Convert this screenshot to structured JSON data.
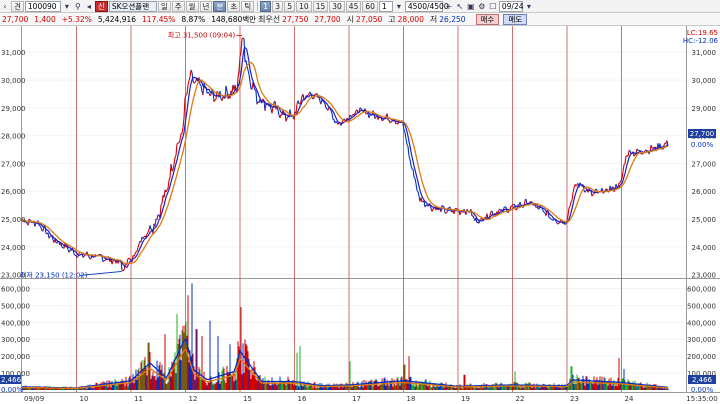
{
  "toolbar": {
    "period_first": "견",
    "code": "100090",
    "chart_badge": "신",
    "stock_name": "SK오션플랜",
    "periods": [
      "일",
      "주",
      "월",
      "년",
      "분",
      "초",
      "틱"
    ],
    "intervals": [
      "1",
      "3",
      "5",
      "10",
      "15",
      "30",
      "45",
      "60"
    ],
    "interval_value": "1",
    "count": "4500/4500",
    "date": "09/24"
  },
  "quote": {
    "price": "27,700",
    "change": "1,400",
    "change_pct": "+5.32%",
    "volume": "5,424,916",
    "volume_ratio": "117.45%",
    "turnover": "8.87%",
    "amount": "148,680백만",
    "hoga_label": "최우선",
    "hoga_value": "27,750",
    "close_value": "27,700",
    "open_label": "시",
    "open": "27,050",
    "high_label": "고",
    "high": "28,000",
    "low_label": "저",
    "low": "26,250",
    "buy": "매수",
    "sell": "매도"
  },
  "legend": {
    "lc": "LC:19.65",
    "hc": "HC:-12.06"
  },
  "annotations": {
    "high": "최고 31,500 (09:04)",
    "low": "최저 23,150 (12:02)"
  },
  "price_axis": {
    "ticks": [
      "31,000",
      "30,000",
      "29,000",
      "28,000",
      "27,000",
      "26,000",
      "25,000",
      "24,000",
      "23,000"
    ],
    "current": "27,700",
    "current_pct": "0.00%"
  },
  "volume_axis": {
    "ticks": [
      "600,000",
      "500,000",
      "400,000",
      "300,000",
      "200,000",
      "100,000"
    ],
    "current": "2,466",
    "current_pct": "0.00%",
    "left_ticks": [
      "600,000",
      "500,000",
      "400,000",
      "300,000",
      "200,000",
      "100,000"
    ],
    "left_current": "2,466",
    "left_current_pct": "0.00%"
  },
  "date_axis": {
    "labels": [
      "09/09",
      "10",
      "11",
      "12",
      "15",
      "16",
      "17",
      "18",
      "19",
      "22",
      "23",
      "24"
    ],
    "time": "15:35:00"
  },
  "colors": {
    "up": "#d40000",
    "down": "#0030c0",
    "ma_short": "#2020c0",
    "ma_long": "#e07a10",
    "vol_green": "#22b022",
    "day_sep": "#c0504d"
  },
  "chart_data": {
    "type": "line",
    "price_ylim": [
      22950,
      31800
    ],
    "volume_ylim": [
      0,
      650000
    ],
    "days": [
      "09/09",
      "10",
      "11",
      "12",
      "15",
      "16",
      "17",
      "18",
      "19",
      "22",
      "23",
      "24"
    ],
    "price_profile": [
      [
        0,
        24950
      ],
      [
        0.3,
        24850
      ],
      [
        0.55,
        24300
      ],
      [
        1.0,
        23750
      ],
      [
        1.5,
        23600
      ],
      [
        1.8,
        23450
      ],
      [
        2.0,
        23500
      ],
      [
        2.2,
        24300
      ],
      [
        2.45,
        24900
      ],
      [
        2.65,
        26000
      ],
      [
        2.8,
        27300
      ],
      [
        2.95,
        28200
      ],
      [
        3.0,
        29300
      ],
      [
        3.08,
        30100
      ],
      [
        3.25,
        29800
      ],
      [
        3.5,
        29400
      ],
      [
        3.75,
        29500
      ],
      [
        3.95,
        29700
      ],
      [
        4.0,
        30800
      ],
      [
        4.05,
        31200
      ],
      [
        4.15,
        30300
      ],
      [
        4.3,
        29400
      ],
      [
        4.6,
        29000
      ],
      [
        4.85,
        28700
      ],
      [
        5.0,
        28700
      ],
      [
        5.1,
        29300
      ],
      [
        5.3,
        29500
      ],
      [
        5.55,
        29200
      ],
      [
        5.8,
        28400
      ],
      [
        6.0,
        28700
      ],
      [
        6.2,
        28900
      ],
      [
        6.5,
        28700
      ],
      [
        6.8,
        28600
      ],
      [
        7.0,
        28400
      ],
      [
        7.1,
        27300
      ],
      [
        7.3,
        25700
      ],
      [
        7.55,
        25400
      ],
      [
        7.8,
        25300
      ],
      [
        8.0,
        25300
      ],
      [
        8.2,
        25300
      ],
      [
        8.35,
        24900
      ],
      [
        8.6,
        25200
      ],
      [
        8.8,
        25300
      ],
      [
        9.0,
        25400
      ],
      [
        9.3,
        25600
      ],
      [
        9.55,
        25300
      ],
      [
        9.75,
        25000
      ],
      [
        9.95,
        24900
      ],
      [
        10.0,
        25000
      ],
      [
        10.1,
        25900
      ],
      [
        10.2,
        26300
      ],
      [
        10.45,
        25900
      ],
      [
        10.7,
        26000
      ],
      [
        10.95,
        26200
      ],
      [
        11.0,
        26400
      ],
      [
        11.1,
        27400
      ],
      [
        11.3,
        27400
      ],
      [
        11.5,
        27500
      ],
      [
        11.7,
        27600
      ],
      [
        11.85,
        27700
      ]
    ],
    "volume_profile": [
      [
        0,
        18000
      ],
      [
        1.0,
        12000
      ],
      [
        2.0,
        55000
      ],
      [
        2.35,
        160000
      ],
      [
        2.65,
        70000
      ],
      [
        3.0,
        310000
      ],
      [
        3.15,
        120000
      ],
      [
        3.4,
        60000
      ],
      [
        3.9,
        110000
      ],
      [
        4.0,
        230000
      ],
      [
        4.4,
        50000
      ],
      [
        5.0,
        50000
      ],
      [
        5.5,
        25000
      ],
      [
        6.0,
        30000
      ],
      [
        7.0,
        55000
      ],
      [
        7.3,
        45000
      ],
      [
        8.0,
        22000
      ],
      [
        9.0,
        30000
      ],
      [
        10.0,
        25000
      ],
      [
        10.1,
        60000
      ],
      [
        11.0,
        45000
      ],
      [
        11.85,
        15000
      ]
    ],
    "volume_spikes": [
      [
        2.32,
        280000
      ],
      [
        2.62,
        330000
      ],
      [
        2.85,
        450000
      ],
      [
        3.05,
        560000
      ],
      [
        3.12,
        630000
      ],
      [
        3.2,
        360000
      ],
      [
        3.3,
        320000
      ],
      [
        3.45,
        410000
      ],
      [
        3.6,
        320000
      ],
      [
        3.82,
        270000
      ],
      [
        4.02,
        490000
      ],
      [
        4.15,
        230000
      ],
      [
        5.05,
        220000
      ],
      [
        5.1,
        260000
      ],
      [
        6.02,
        170000
      ],
      [
        7.02,
        150000
      ],
      [
        7.1,
        200000
      ],
      [
        8.12,
        90000
      ],
      [
        9.05,
        110000
      ],
      [
        10.08,
        140000
      ],
      [
        10.95,
        190000
      ],
      [
        11.05,
        125000
      ]
    ],
    "high_point": {
      "day_pos": 4.06,
      "value": 31500
    },
    "low_point": {
      "day_pos": 1.85,
      "value": 23150
    }
  }
}
